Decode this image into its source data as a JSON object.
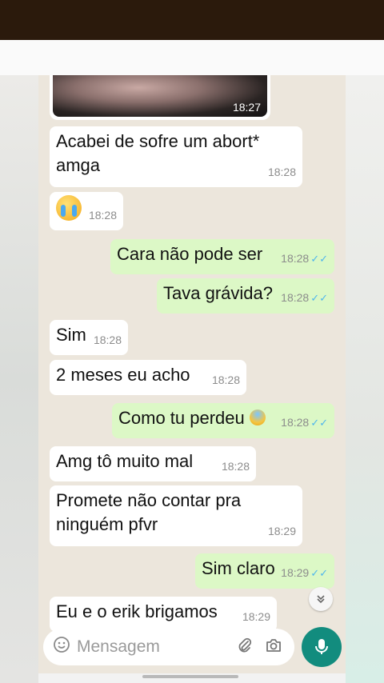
{
  "chat": {
    "photo_time": "18:27",
    "messages": [
      {
        "dir": "in",
        "text1": "Acabei de sofre um abort*",
        "text2": "amga",
        "time": "18:28"
      },
      {
        "dir": "in",
        "emoji": "crying-face",
        "time": "18:28"
      },
      {
        "dir": "out",
        "text": "Cara não pode ser",
        "time": "18:28"
      },
      {
        "dir": "out",
        "text": "Tava grávida?",
        "time": "18:28"
      },
      {
        "dir": "in",
        "text": "Sim",
        "time": "18:28"
      },
      {
        "dir": "in",
        "text": "2 meses eu acho",
        "time": "18:28"
      },
      {
        "dir": "out",
        "text": "Como tu perdeu",
        "emoji": "fearful-face",
        "time": "18:28"
      },
      {
        "dir": "in",
        "text": "Amg tô muito mal",
        "time": "18:28"
      },
      {
        "dir": "in",
        "text1": "Promete não contar pra",
        "text2": "ninguém pfvr",
        "time": "18:29"
      },
      {
        "dir": "out",
        "text": "Sim claro",
        "time": "18:29"
      },
      {
        "dir": "in",
        "text": "Eu e o erik brigamos",
        "time": "18:29"
      }
    ],
    "read_ticks": "✓✓"
  },
  "input": {
    "placeholder": "Mensagem"
  },
  "icons": {
    "emoji_button": "smiley-icon",
    "attach": "paperclip-icon",
    "camera": "camera-icon",
    "mic": "microphone-icon",
    "scroll_down": "double-chevron-down-icon"
  },
  "colors": {
    "incoming_bubble": "#ffffff",
    "outgoing_bubble": "#dcf8c6",
    "chat_background": "#ece6dc",
    "read_ticks": "#4fb6ec",
    "mic_button": "#128c7e"
  }
}
